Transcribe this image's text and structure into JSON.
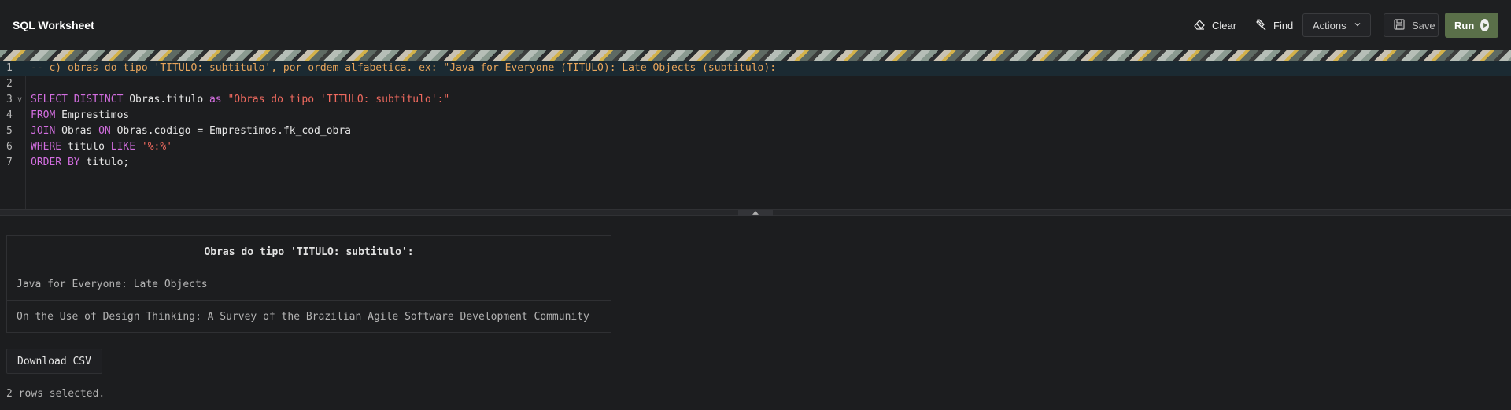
{
  "header": {
    "title": "SQL Worksheet",
    "clear_label": "Clear",
    "find_label": "Find",
    "actions_label": "Actions",
    "save_label": "Save",
    "run_label": "Run"
  },
  "editor": {
    "lines": [
      {
        "number": "1",
        "tokens": [
          {
            "type": "comment",
            "text": "-- c) obras do tipo 'TITULO: subtitulo', por ordem alfabetica. ex: \"Java for Everyone (TITULO): Late Objects (subtitulo):"
          }
        ]
      },
      {
        "number": "2",
        "tokens": []
      },
      {
        "number": "3",
        "fold": "v",
        "tokens": [
          {
            "type": "kw",
            "text": "SELECT DISTINCT "
          },
          {
            "type": "id",
            "text": "Obras.titulo "
          },
          {
            "type": "kw",
            "text": "as "
          },
          {
            "type": "str",
            "text": "\"Obras do tipo 'TITULO: subtitulo':\""
          }
        ]
      },
      {
        "number": "4",
        "tokens": [
          {
            "type": "kw",
            "text": "FROM "
          },
          {
            "type": "id",
            "text": "Emprestimos"
          }
        ]
      },
      {
        "number": "5",
        "tokens": [
          {
            "type": "kw",
            "text": "JOIN "
          },
          {
            "type": "id",
            "text": "Obras "
          },
          {
            "type": "kw",
            "text": "ON "
          },
          {
            "type": "id",
            "text": "Obras.codigo = Emprestimos.fk_cod_obra"
          }
        ]
      },
      {
        "number": "6",
        "tokens": [
          {
            "type": "kw",
            "text": "WHERE "
          },
          {
            "type": "id",
            "text": "titulo "
          },
          {
            "type": "kw",
            "text": "LIKE "
          },
          {
            "type": "str",
            "text": "'%:%'"
          }
        ]
      },
      {
        "number": "7",
        "tokens": [
          {
            "type": "kw",
            "text": "ORDER BY "
          },
          {
            "type": "id",
            "text": "titulo;"
          }
        ]
      }
    ]
  },
  "results": {
    "column_header": "Obras do tipo 'TITULO: subtitulo':",
    "rows": [
      "Java for Everyone: Late Objects",
      "On the Use of Design Thinking: A Survey of the Brazilian Agile Software Development Community"
    ],
    "download_label": "Download CSV",
    "status": "2 rows selected."
  },
  "colors": {
    "comment": "#e8a55b",
    "keyword": "#d36ee0",
    "string": "#f06a5f",
    "run_button": "#5a6f49",
    "active_line": "#1b2a32"
  }
}
